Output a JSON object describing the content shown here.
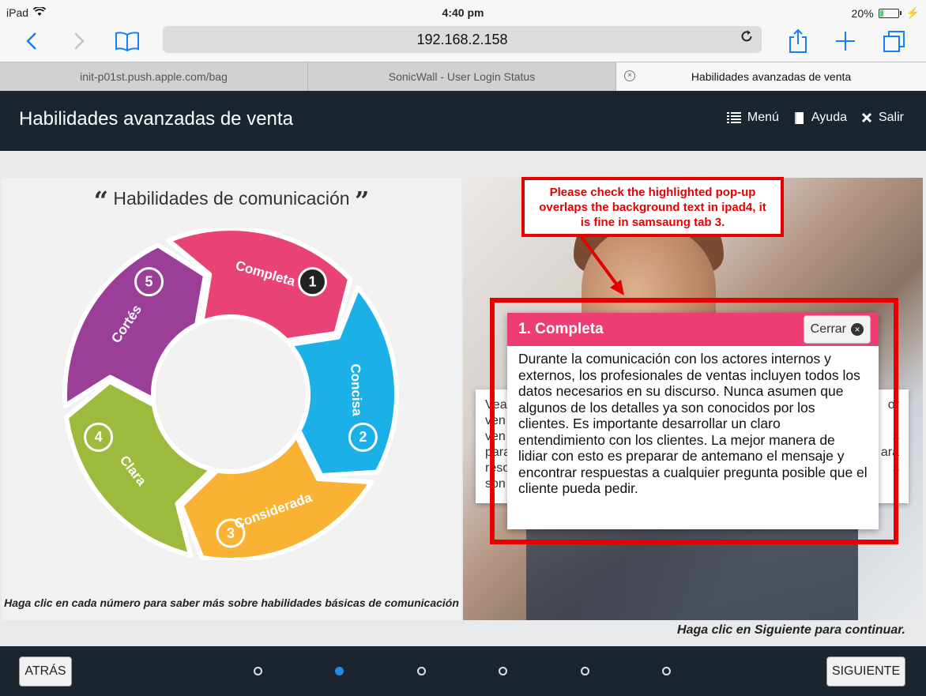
{
  "status_bar": {
    "device": "iPad",
    "time": "4:40 pm",
    "battery": "20%",
    "battery_level": 0.2
  },
  "browser": {
    "url": "192.168.2.158",
    "tabs": [
      {
        "label": "init-p01st.push.apple.com/bag"
      },
      {
        "label": "SonicWall - User Login Status"
      },
      {
        "label": "Habilidades avanzadas de venta"
      }
    ],
    "close_glyph": "×",
    "icons": {
      "back": "chevron-left-icon",
      "forward": "chevron-right-icon",
      "bookmarks": "book-icon",
      "reload": "reload-icon",
      "share": "share-icon",
      "new_tab": "plus-icon",
      "tabs": "tabs-icon"
    }
  },
  "app": {
    "title": "Habilidades avanzadas de venta",
    "nav": {
      "menu": "Menú",
      "help": "Ayuda",
      "exit": "Salir"
    }
  },
  "left": {
    "heading": "Habilidades de comunicación",
    "open_quote": "“",
    "close_quote": "”",
    "caption": "Haga clic en cada número para saber más sobre habilidades básicas de comunicación",
    "segments": [
      {
        "num": "1",
        "label": "Completa",
        "color": "#e94375"
      },
      {
        "num": "2",
        "label": "Concisa",
        "color": "#1bb0e8"
      },
      {
        "num": "3",
        "label": "Considerada",
        "color": "#f9b233"
      },
      {
        "num": "4",
        "label": "Clara",
        "color": "#9dba3c"
      },
      {
        "num": "5",
        "label": "Cortés",
        "color": "#9b3e97"
      }
    ]
  },
  "right": {
    "bg_text_lines": [
      {
        "start": "Vea",
        "end": "or"
      },
      {
        "start": "ven",
        "end": ""
      },
      {
        "start": "ven",
        "end": "s"
      },
      {
        "start": "para",
        "end": "ara"
      },
      {
        "start": "reso",
        "end": "s"
      },
      {
        "start": "son",
        "end": ""
      }
    ],
    "annotation": "Please check the highlighted pop-up overlaps the background text in ipad4, it is fine in samsaung tab 3.",
    "popup": {
      "title": "1. Completa",
      "close_label": "Cerrar",
      "body": "Durante la comunicación con los actores internos y externos, los profesionales de ventas incluyen todos los datos necesarios en su discurso. Nunca asumen que algunos de los detalles ya son conocidos por los clientes. Es importante desarrollar un claro entendimiento con los clientes. La mejor manera de lidiar con esto es preparar de antemano el mensaje y encontrar respuestas a cualquier pregunta posible que el cliente pueda pedir."
    },
    "continue_hint": "Haga clic en Siguiente para continuar."
  },
  "footer": {
    "prev_label": "ATRÁS",
    "next_label": "SIGUIENTE",
    "page_count": 6,
    "active_page": 2
  },
  "colors": {
    "header_bg": "#1b2530",
    "accent": "#ee3d73",
    "annotation_red": "#e60000",
    "active_dot": "#1e8ee8",
    "safari_blue": "#147efb"
  }
}
